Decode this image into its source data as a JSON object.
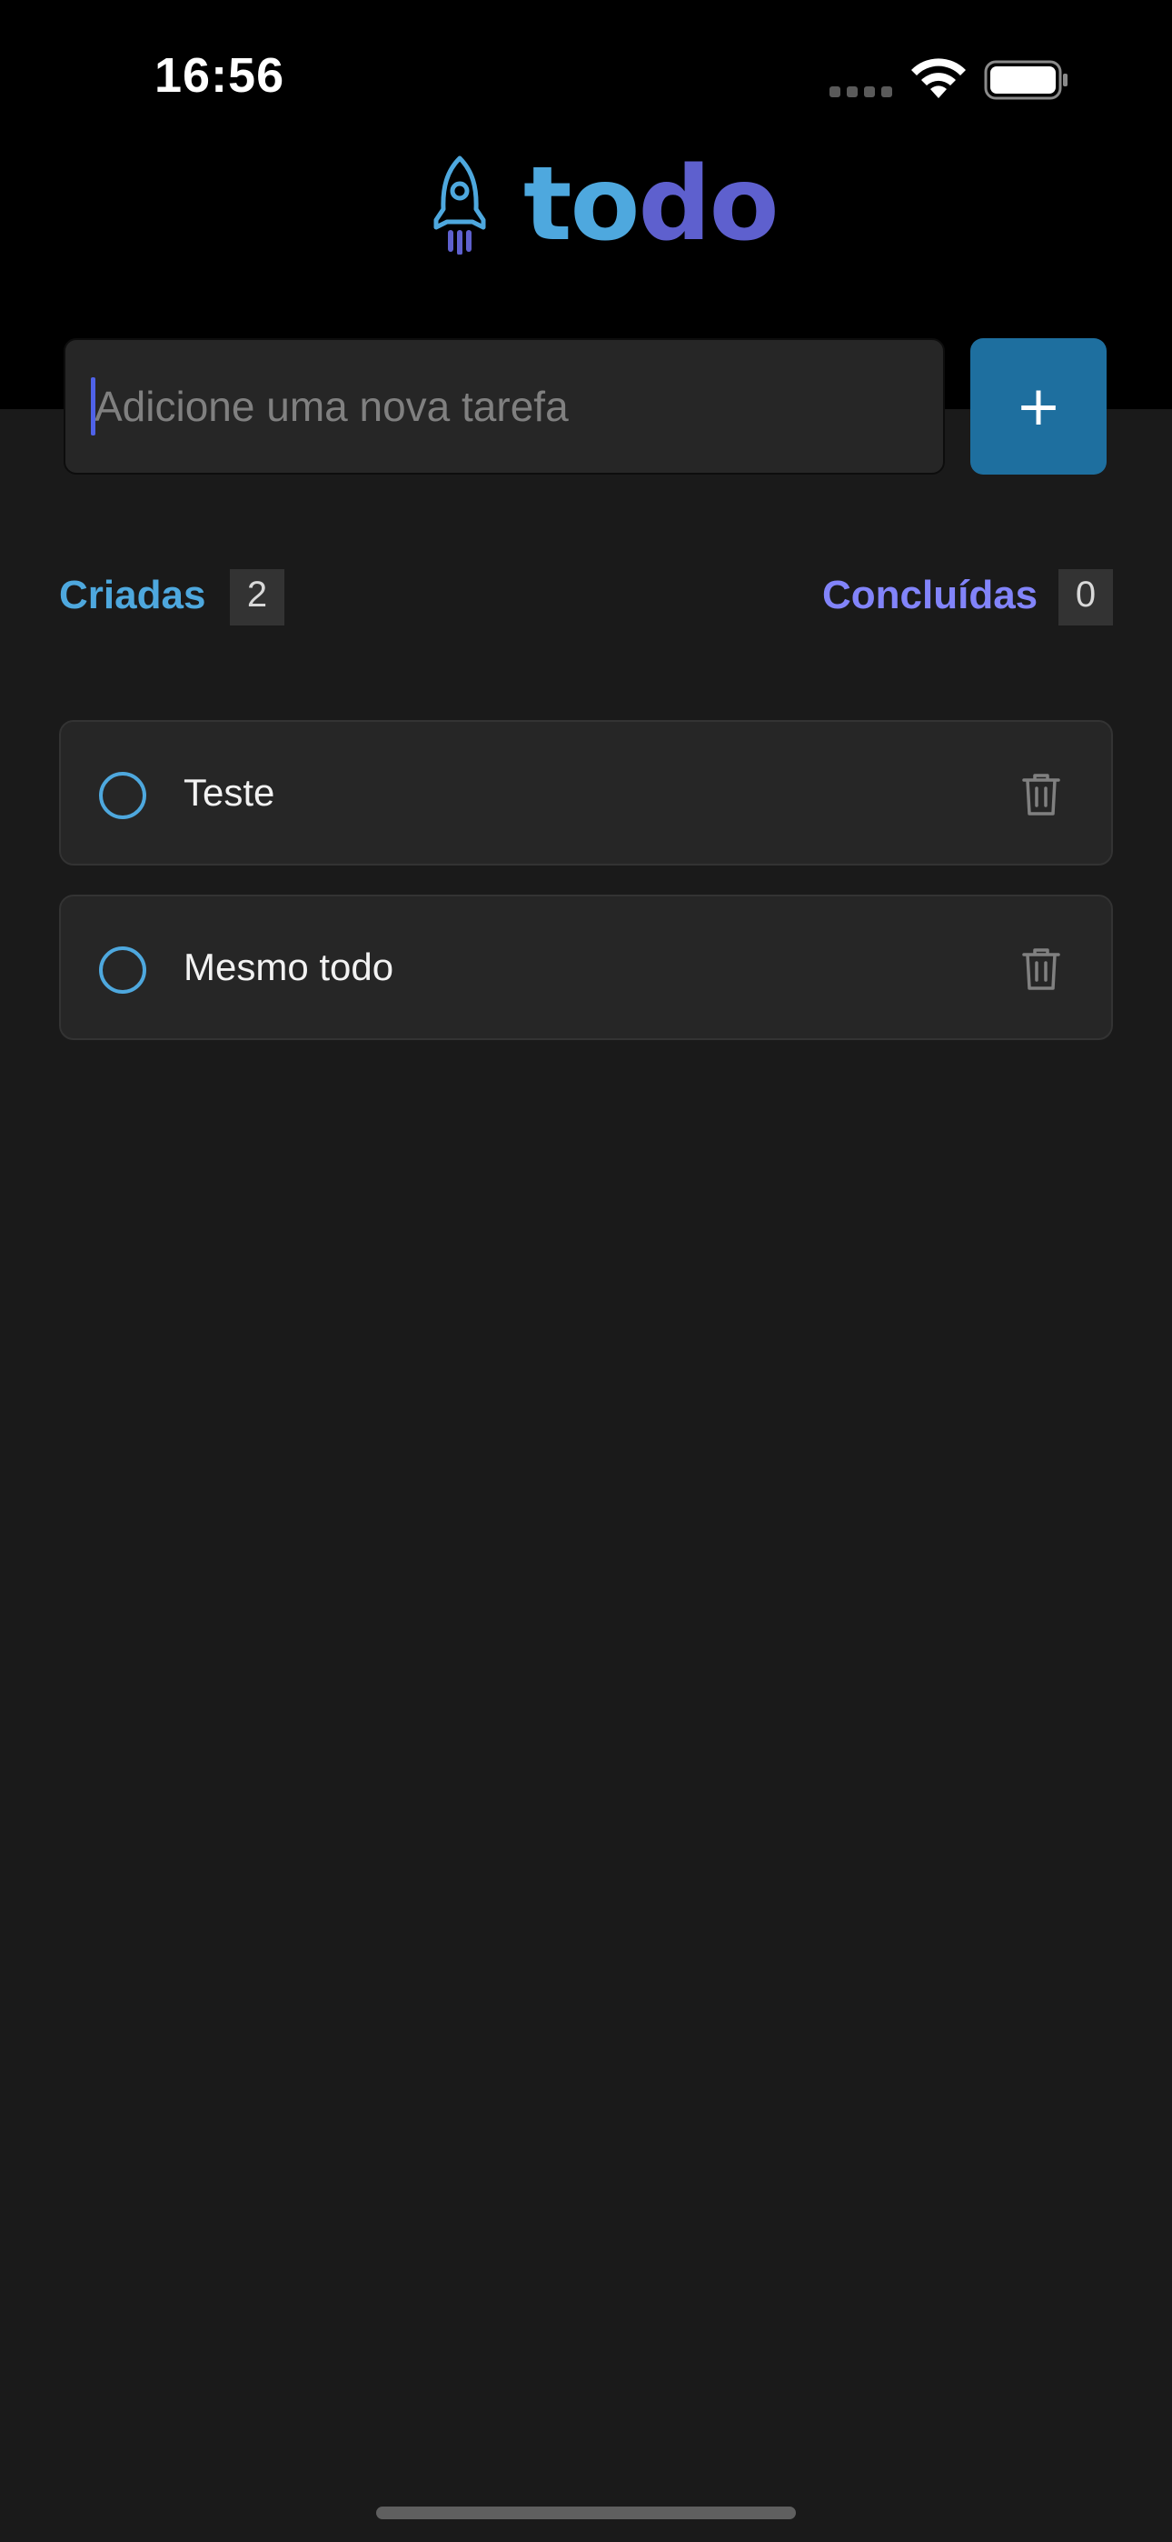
{
  "status_bar": {
    "time": "16:56"
  },
  "logo": {
    "icon": "rocket-icon",
    "text_part1": "to",
    "text_part2": "do",
    "colors": {
      "to": "#4ea8de",
      "do": "#5e60ce"
    }
  },
  "input": {
    "placeholder": "Adicione uma nova tarefa",
    "value": ""
  },
  "add_button": {
    "label": "+",
    "color": "#1e6f9f"
  },
  "counters": {
    "created_label": "Criadas",
    "created_count": "2",
    "done_label": "Concluídas",
    "done_count": "0"
  },
  "tasks": [
    {
      "text": "Teste",
      "done": false
    },
    {
      "text": "Mesmo todo",
      "done": false
    }
  ]
}
